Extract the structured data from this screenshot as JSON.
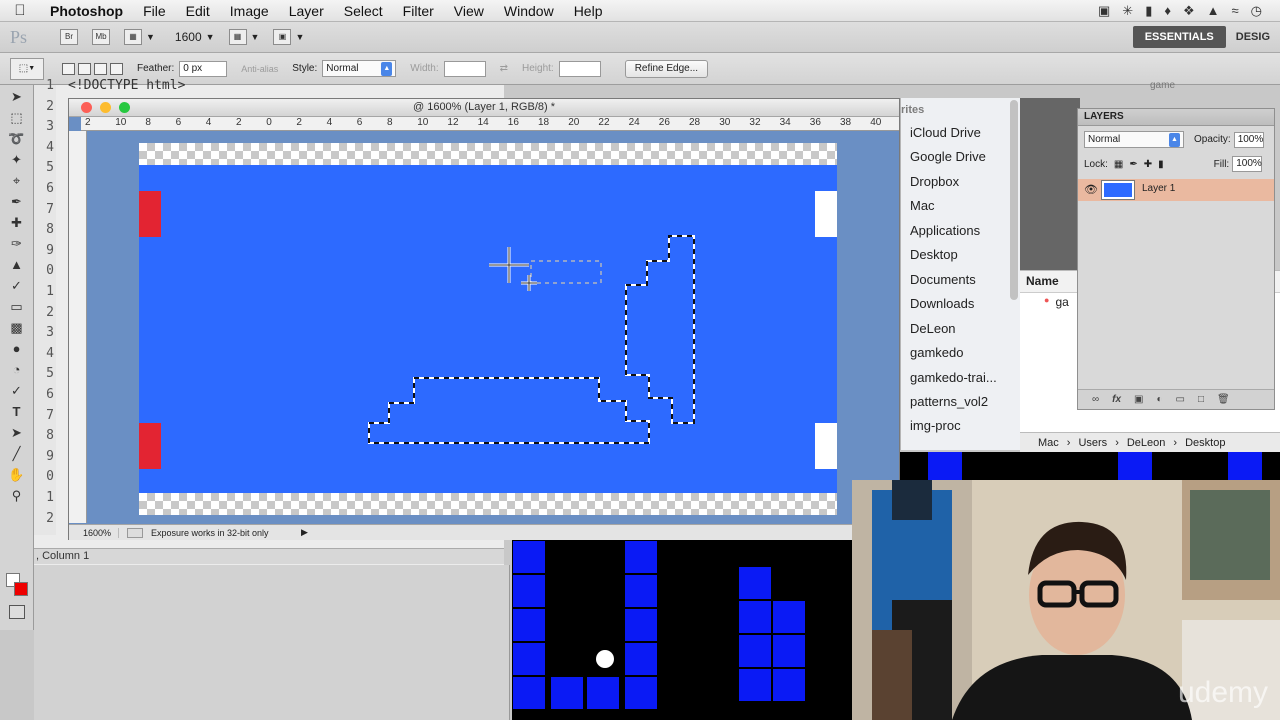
{
  "menubar": {
    "app": "Photoshop",
    "items": [
      "File",
      "Edit",
      "Image",
      "Layer",
      "Select",
      "Filter",
      "View",
      "Window",
      "Help"
    ]
  },
  "appbar": {
    "logo": "Ps",
    "bridge": "Br",
    "minibridge": "Mb",
    "zoom": "1600",
    "workspace_active": "ESSENTIALS",
    "workspace_next": "DESIG"
  },
  "options": {
    "feather_label": "Feather:",
    "feather_value": "0 px",
    "antialias": "Anti-alias",
    "style_label": "Style:",
    "style_value": "Normal",
    "width_label": "Width:",
    "height_label": "Height:",
    "refine_edge": "Refine Edge..."
  },
  "editor": {
    "doctype": "<!DOCTYPE html>",
    "line_numbers": [
      "1",
      "2",
      "3",
      "4",
      "5",
      "6",
      "7",
      "8",
      "9",
      "0",
      "1",
      "2",
      "3",
      "4",
      "5",
      "6",
      "7",
      "8",
      "9",
      "0",
      "1",
      "2"
    ],
    "status": ", Column 1"
  },
  "document": {
    "title": "@ 1600% (Layer 1, RGB/8) *",
    "ruler_ticks": [
      "2",
      "10",
      "8",
      "6",
      "4",
      "2",
      "0",
      "2",
      "4",
      "6",
      "8",
      "10",
      "12",
      "14",
      "16",
      "18",
      "20",
      "22",
      "24",
      "26",
      "28",
      "30",
      "32",
      "34",
      "36",
      "38",
      "40"
    ],
    "zoom": "1600%",
    "status_message": "Exposure works in 32-bit only"
  },
  "finder": {
    "header": "rites",
    "items": [
      "iCloud Drive",
      "Google Drive",
      "Dropbox",
      "Mac",
      "Applications",
      "Desktop",
      "Documents",
      "Downloads",
      "DeLeon",
      "gamkedo",
      "gamkedo-trai...",
      "patterns_vol2",
      "img-proc"
    ],
    "name_col": "Name",
    "file": "ga",
    "folder_title": "game",
    "path": [
      "Mac",
      "Users",
      "DeLeon",
      "Desktop"
    ]
  },
  "layers": {
    "tab": "LAYERS",
    "blend": "Normal",
    "opacity_label": "Opacity:",
    "opacity": "100%",
    "lock_label": "Lock:",
    "fill_label": "Fill:",
    "fill": "100%",
    "layer_name": "Layer 1"
  },
  "watermark": "udemy",
  "colors": {
    "canvas": "#2d6aff",
    "paddle_left": "#e32432",
    "game_block": "#0a1af5"
  }
}
